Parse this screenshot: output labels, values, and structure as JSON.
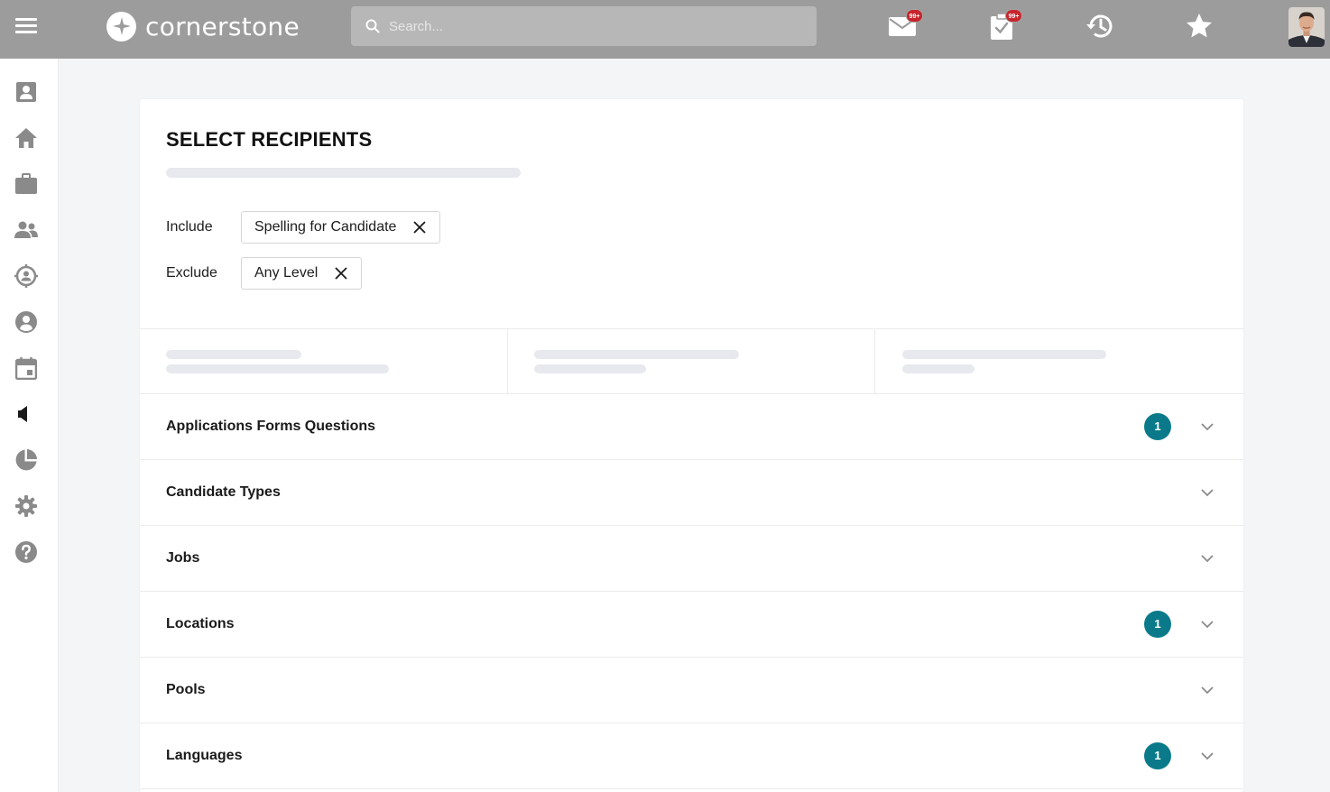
{
  "header": {
    "brand": "cornerstone",
    "search_placeholder": "Search...",
    "mail_badge": "99+",
    "tasks_badge": "99+",
    "icons": [
      "menu-icon",
      "mail-icon",
      "tasks-icon",
      "history-icon",
      "star-icon",
      "user-avatar"
    ]
  },
  "sidebar": {
    "icons": [
      "profile-card-icon",
      "home-icon",
      "briefcase-icon",
      "people-icon",
      "target-person-icon",
      "user-circle-icon",
      "calendar-icon",
      "megaphone-icon",
      "pie-chart-icon",
      "gear-icon",
      "help-icon"
    ],
    "active": "megaphone-icon"
  },
  "main": {
    "title": "SELECT RECIPIENTS",
    "filters": [
      {
        "label": "Include",
        "value": "Spelling for Candidate"
      },
      {
        "label": "Exclude",
        "value": "Any Level"
      }
    ],
    "sections": [
      {
        "label": "Applications Forms Questions",
        "count": "1"
      },
      {
        "label": "Candidate Types",
        "count": ""
      },
      {
        "label": "Jobs",
        "count": ""
      },
      {
        "label": "Locations",
        "count": "1"
      },
      {
        "label": "Pools",
        "count": ""
      },
      {
        "label": "Languages",
        "count": "1"
      }
    ]
  },
  "colors": {
    "topbar": "#9c9c9c",
    "badge": "#c8242b",
    "count_badge": "#0a7a8a",
    "skeleton": "#e7e9ee"
  }
}
